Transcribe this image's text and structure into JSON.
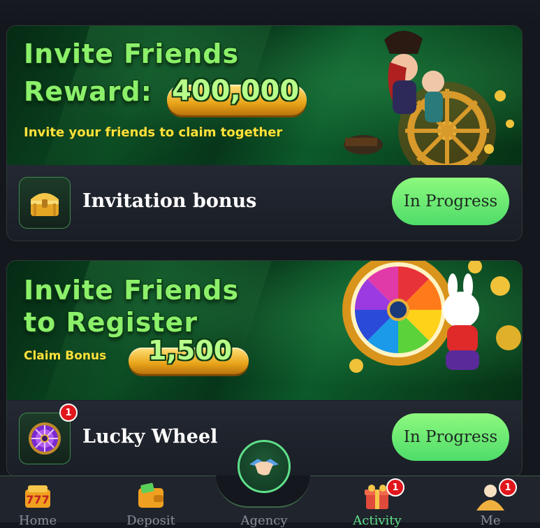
{
  "cards": [
    {
      "banner": {
        "title_line1": "Invite Friends",
        "title_line2": "Reward:",
        "amount": "400,000",
        "subtitle": "Invite your friends to claim together"
      },
      "title": "Invitation bonus",
      "button_label": "In Progress",
      "icon": "treasure-chest-icon"
    },
    {
      "banner": {
        "title_line1": "Invite Friends",
        "title_line2": "to Register",
        "subtitle": "Claim Bonus",
        "amount": "1,500"
      },
      "title": "Lucky Wheel",
      "button_label": "In Progress",
      "icon": "wheel-icon",
      "badge": "1"
    }
  ],
  "nav": {
    "items": [
      {
        "label": "Home",
        "icon": "home-icon"
      },
      {
        "label": "Deposit",
        "icon": "wallet-icon"
      },
      {
        "label": "Agency",
        "icon": "handshake-icon"
      },
      {
        "label": "Activity",
        "icon": "gift-icon",
        "badge": "1",
        "active": true
      },
      {
        "label": "Me",
        "icon": "user-icon",
        "badge": "1"
      }
    ]
  },
  "colors": {
    "accent": "#5fe08a",
    "button": "#6cea74",
    "badge": "#e0161b",
    "background": "#14171e"
  }
}
